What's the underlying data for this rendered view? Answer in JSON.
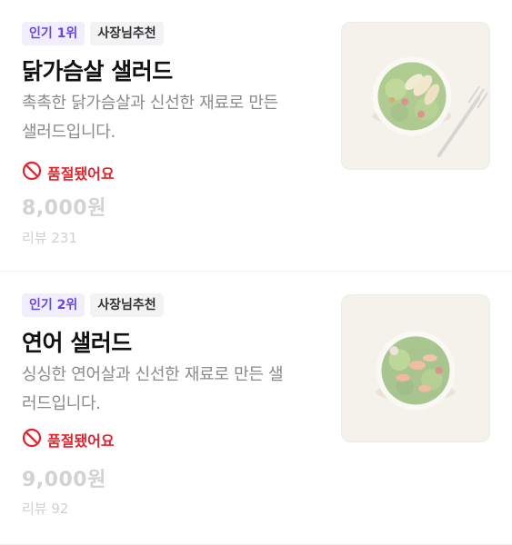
{
  "items": [
    {
      "rank_badge": "인기 1위",
      "pick_badge": "사장님추천",
      "name": "닭가슴살 샐러드",
      "desc_line1": "촉촉한 닭가슴살과 신선한 재료로 만든",
      "desc_line2": "샐러드입니다.",
      "status": "품절됐어요",
      "price": "8,000원",
      "reviews": "리뷰 231",
      "photo_icon": "chicken-salad-image"
    },
    {
      "rank_badge": "인기 2위",
      "pick_badge": "사장님추천",
      "name": "연어 샐러드",
      "desc_line1": "싱싱한 연어살과 신선한 재료로 만든 샐",
      "desc_line2": "러드입니다.",
      "status": "품절됐어요",
      "price": "9,000원",
      "reviews": "리뷰 92",
      "photo_icon": "salmon-salad-image"
    }
  ],
  "colors": {
    "accent": "#6b45e0",
    "soldout": "#e0242e",
    "muted": "#d2d2d2"
  }
}
